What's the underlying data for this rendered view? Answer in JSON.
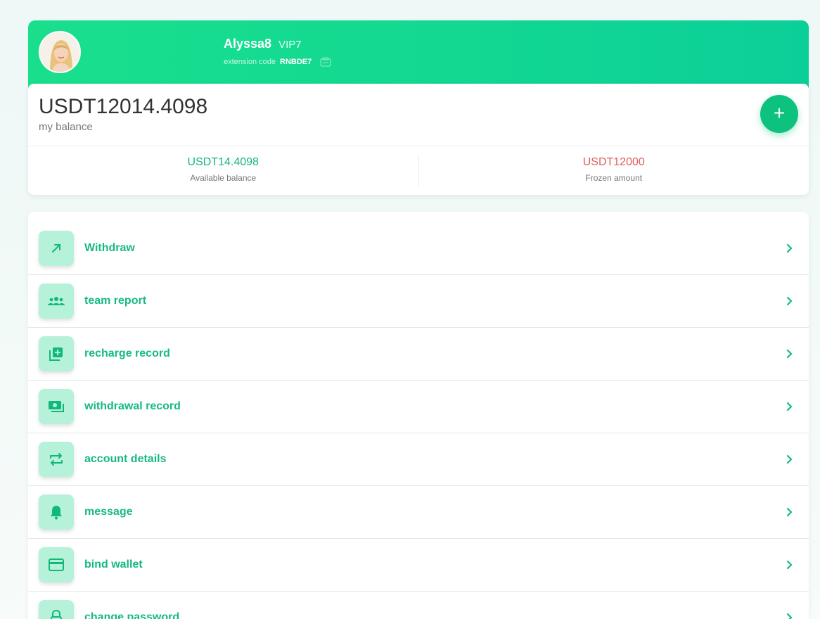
{
  "header": {
    "username": "Alyssa8",
    "vip_level": "VIP7",
    "extension_label": "extension code",
    "extension_code": "RNBDE7",
    "avatar_icon": "user-avatar",
    "copy_icon": "copy-icon"
  },
  "balance": {
    "total": "USDT12014.4098",
    "total_label": "my balance",
    "add_symbol": "+",
    "available_value": "USDT14.4098",
    "available_label": "Available balance",
    "frozen_value": "USDT12000",
    "frozen_label": "Frozen amount"
  },
  "menu": {
    "items": [
      {
        "label": "Withdraw",
        "icon": "arrow-up-right-icon"
      },
      {
        "label": "team report",
        "icon": "team-icon"
      },
      {
        "label": "recharge record",
        "icon": "add-record-icon"
      },
      {
        "label": "withdrawal record",
        "icon": "cash-icon"
      },
      {
        "label": "account details",
        "icon": "swap-icon"
      },
      {
        "label": "message",
        "icon": "bell-icon"
      },
      {
        "label": "bind wallet",
        "icon": "card-icon"
      },
      {
        "label": "change password",
        "icon": "lock-icon"
      }
    ]
  },
  "colors": {
    "accent": "#16b983",
    "header_gradient_start": "#19df8d",
    "header_gradient_end": "#0bcf99",
    "icon_bg": "#b5f2d9",
    "frozen": "#e05d5d"
  }
}
